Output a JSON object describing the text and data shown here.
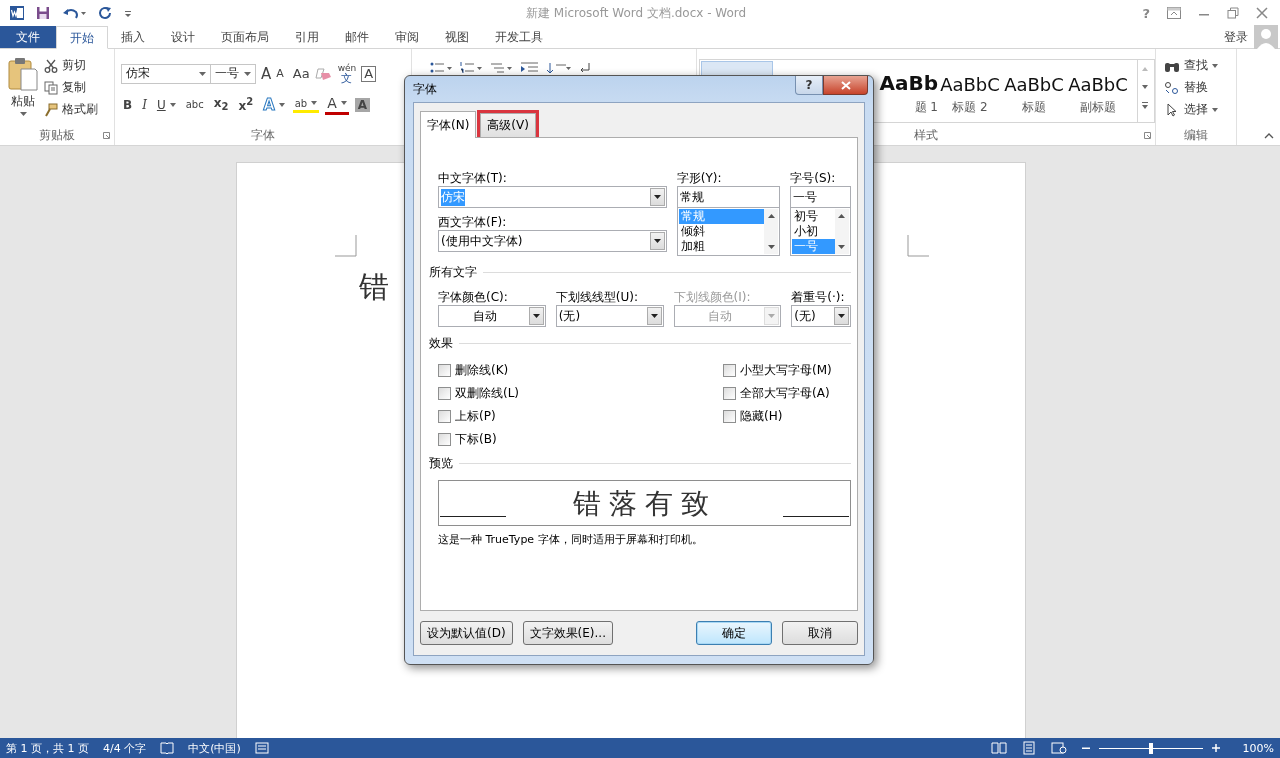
{
  "window": {
    "title": "新建 Microsoft Word 文档.docx - Word",
    "help": "?",
    "account": "登录"
  },
  "ribbon_tabs": [
    {
      "label": "文件",
      "kind": "file",
      "selected": false
    },
    {
      "label": "开始",
      "kind": "tab",
      "selected": true
    },
    {
      "label": "插入",
      "kind": "tab",
      "selected": false
    },
    {
      "label": "设计",
      "kind": "tab",
      "selected": false
    },
    {
      "label": "页面布局",
      "kind": "tab",
      "selected": false
    },
    {
      "label": "引用",
      "kind": "tab",
      "selected": false
    },
    {
      "label": "邮件",
      "kind": "tab",
      "selected": false
    },
    {
      "label": "审阅",
      "kind": "tab",
      "selected": false
    },
    {
      "label": "视图",
      "kind": "tab",
      "selected": false
    },
    {
      "label": "开发工具",
      "kind": "tab",
      "selected": false
    }
  ],
  "clipboard": {
    "paste": "粘贴",
    "actions": [
      {
        "label": "剪切",
        "kind": "cut"
      },
      {
        "label": "复制",
        "kind": "copy"
      },
      {
        "label": "格式刷",
        "kind": "brush"
      }
    ],
    "label": "剪贴板"
  },
  "font_group": {
    "font": "仿宋",
    "size": "一号",
    "grow": "A",
    "shrink": "A",
    "case": "Aa",
    "phonetic": "wén",
    "phonetic_char": "文",
    "border_char": "A",
    "label": "字体",
    "format": [
      {
        "text": "B",
        "kind": "bold",
        "dropdown": false
      },
      {
        "text": "I",
        "kind": "italic",
        "dropdown": false
      },
      {
        "text": "U",
        "kind": "underline",
        "dropdown": true
      },
      {
        "text": "abc",
        "kind": "strike",
        "dropdown": false
      },
      {
        "text": "x$_{2}$",
        "kind": "plain",
        "dropdown": false
      },
      {
        "text": "x$^{2}$",
        "kind": "plain",
        "dropdown": false
      },
      {
        "text": "A",
        "kind": "effect",
        "dropdown": true
      },
      {
        "text": "ab",
        "kind": "highlight",
        "dropdown": true
      },
      {
        "text": "A",
        "kind": "color",
        "dropdown": true
      },
      {
        "text": "A",
        "kind": "shading",
        "dropdown": false
      }
    ]
  },
  "styles": {
    "items": [
      {
        "sample": "AaBb",
        "name": "题 1",
        "kind": "heading1"
      },
      {
        "sample": "AaBbC",
        "name": "标题 2",
        "kind": "heading2"
      },
      {
        "sample": "AaBbC",
        "name": "标题",
        "kind": "title"
      },
      {
        "sample": "AaBbC",
        "name": "副标题",
        "kind": "subtitle"
      }
    ],
    "label": "样式"
  },
  "editing": {
    "actions": [
      {
        "label": "查找",
        "kind": "find",
        "dropdown": true
      },
      {
        "label": "替换",
        "kind": "replace",
        "dropdown": false
      },
      {
        "label": "选择",
        "kind": "select",
        "dropdown": true
      }
    ],
    "label": "编辑"
  },
  "document": {
    "text": "错"
  },
  "dialog": {
    "title": "字体",
    "help": "?",
    "tabs": [
      {
        "label": "字体(N)",
        "selected": true,
        "highlighted": false
      },
      {
        "label": "高级(V)",
        "selected": false,
        "highlighted": true
      }
    ],
    "chinese_font": {
      "label": "中文字体(T):",
      "value": "仿宋",
      "highlighted": true
    },
    "western_font": {
      "label": "西文字体(F):",
      "value": "(使用中文字体)"
    },
    "style": {
      "label": "字形(Y):",
      "value": "常规",
      "options": [
        {
          "label": "常规",
          "selected": true
        },
        {
          "label": "倾斜",
          "selected": false
        },
        {
          "label": "加粗",
          "selected": false
        }
      ]
    },
    "size": {
      "label": "字号(S):",
      "value": "一号",
      "options": [
        {
          "label": "初号",
          "selected": false
        },
        {
          "label": "小初",
          "selected": false
        },
        {
          "label": "一号",
          "selected": true
        }
      ]
    },
    "all_text": {
      "heading": "所有文字",
      "dropdowns": [
        {
          "label": "字体颜色(C):",
          "value": "自动",
          "disabled": false
        },
        {
          "label": "下划线线型(U):",
          "value": "(无)",
          "disabled": false
        },
        {
          "label": "下划线颜色(I):",
          "value": "自动",
          "disabled": true
        },
        {
          "label": "着重号(·):",
          "value": "(无)",
          "disabled": false
        }
      ]
    },
    "effects": {
      "heading": "效果",
      "left": [
        {
          "label": "删除线(K)",
          "checked": false
        },
        {
          "label": "双删除线(L)",
          "checked": false
        },
        {
          "label": "上标(P)",
          "checked": false
        },
        {
          "label": "下标(B)",
          "checked": false
        }
      ],
      "right": [
        {
          "label": "小型大写字母(M)",
          "checked": false
        },
        {
          "label": "全部大写字母(A)",
          "checked": false
        },
        {
          "label": "隐藏(H)",
          "checked": false
        }
      ]
    },
    "preview": {
      "heading": "预览",
      "sample": "错落有致",
      "note": "这是一种 TrueType 字体，同时适用于屏幕和打印机。"
    },
    "buttons": [
      {
        "label": "设为默认值(D)",
        "kind": "normal"
      },
      {
        "label": "文字效果(E)...",
        "kind": "normal"
      },
      {
        "label": "确定",
        "kind": "default"
      },
      {
        "label": "取消",
        "kind": "normal"
      }
    ]
  },
  "status_bar": {
    "page": "第 1 页，共 1 页",
    "words": "4/4 个字",
    "language": "中文(中国)",
    "zoom": "100%",
    "level": 0.5
  }
}
